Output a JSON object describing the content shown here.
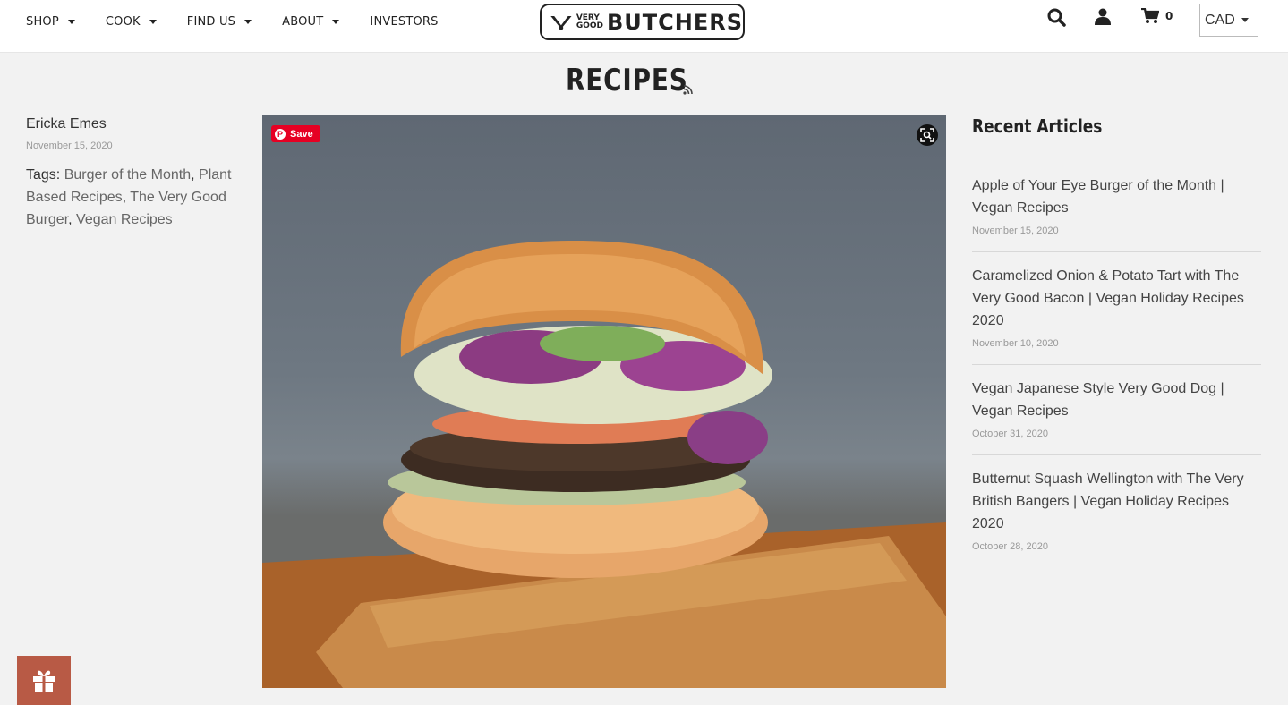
{
  "nav": {
    "shop": "SHOP",
    "cook": "COOK",
    "find_us": "FIND US",
    "about": "ABOUT",
    "investors": "INVESTORS"
  },
  "logo": {
    "small_top": "VERY",
    "small_bottom": "GOOD",
    "big": "BUTCHERS"
  },
  "cart": {
    "count": "0"
  },
  "currency": {
    "selected": "CAD"
  },
  "page": {
    "title": "RECIPES"
  },
  "post": {
    "author": "Ericka Emes",
    "date": "November 15, 2020",
    "tags_label": "Tags:",
    "tags": [
      "Burger of the Month",
      "Plant Based Recipes",
      "The Very Good Burger",
      "Vegan Recipes"
    ]
  },
  "image": {
    "save_label": "Save"
  },
  "sidebar": {
    "title": "Recent Articles",
    "articles": [
      {
        "title": "Apple of Your Eye Burger of the Month | Vegan Recipes",
        "date": "November 15, 2020"
      },
      {
        "title": "Caramelized Onion & Potato Tart with The Very Good Bacon | Vegan Holiday Recipes 2020",
        "date": "November 10, 2020"
      },
      {
        "title": "Vegan Japanese Style Very Good Dog | Vegan Recipes",
        "date": "October 31, 2020"
      },
      {
        "title": "Butternut Squash Wellington with The Very British Bangers | Vegan Holiday Recipes 2020",
        "date": "October 28, 2020"
      }
    ]
  },
  "colors": {
    "pinterest_red": "#e60023",
    "gift_button": "#b85a45",
    "background": "#f2f2f2"
  },
  "icons": [
    "search-icon",
    "user-icon",
    "cart-icon",
    "rss-icon",
    "pinterest-icon",
    "lens-icon",
    "gift-icon",
    "caret-down-icon"
  ]
}
